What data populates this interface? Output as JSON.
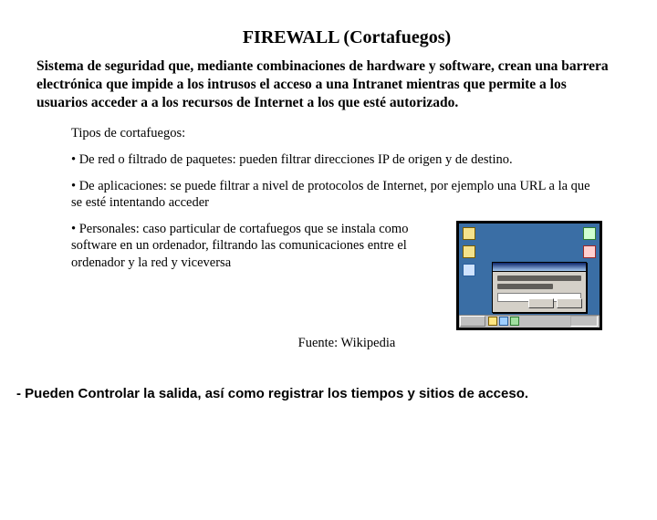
{
  "title": "FIREWALL (Cortafuegos)",
  "intro": "Sistema de seguridad que, mediante combinaciones de hardware y software, crean una barrera electrónica que impide a los intrusos el acceso a una Intranet mientras que permite a los usuarios acceder a a los recursos de Internet a los que esté autorizado.",
  "types_heading": "Tipos de cortafuegos:",
  "types": [
    "• De red o filtrado de paquetes: pueden filtrar direcciones IP de origen y de destino.",
    "• De aplicaciones: se puede filtrar a nivel de protocolos de Internet, por ejemplo una URL a la que se esté intentando acceder",
    "• Personales: caso particular de cortafuegos que se instala como software en un ordenador, filtrando las comunicaciones entre el ordenador y la red y viceversa"
  ],
  "source": "Fuente: Wikipedia",
  "footer": "- Pueden Controlar la salida, así como registrar los tiempos y sitios de acceso."
}
